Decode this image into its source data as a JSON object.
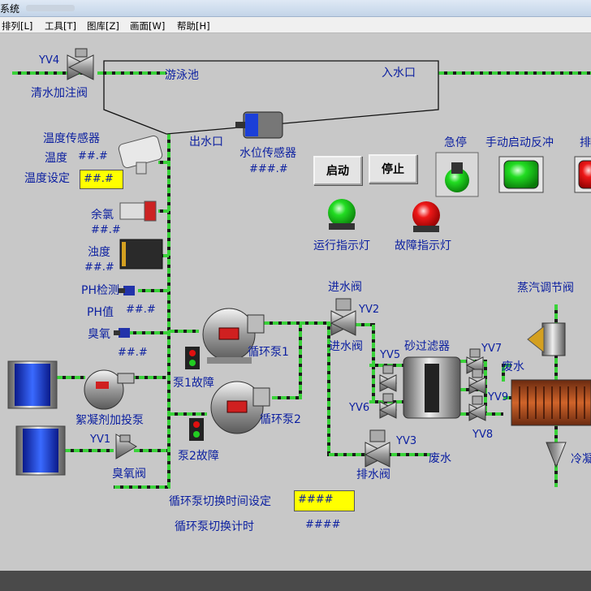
{
  "window": {
    "title": "系统"
  },
  "menu": [
    "排列[L]",
    "工具[T]",
    "图库[Z]",
    "画面[W]",
    "帮助[H]"
  ],
  "labels": {
    "yv4": "YV4",
    "clean_water_valve": "清水加注阀",
    "pool": "游泳池",
    "inlet": "入水口",
    "outlet": "出水口",
    "level_sensor": "水位传感器",
    "level_value": "###.#",
    "temp_sensor": "温度传感器",
    "temp_label": "温度",
    "temp_value": "##.#",
    "temp_setting": "温度设定",
    "temp_setting_value": "##.#",
    "chlorine": "余氯",
    "chlorine_value": "##.#",
    "turbidity": "浊度",
    "turbidity_value": "##.#",
    "ph_detect": "PH检测",
    "ph_value_label": "PH值",
    "ph_value": "##.#",
    "ozone": "臭氧",
    "ozone_value": "##.#",
    "estop": "急停",
    "manual_backwash": "手动启动反冲",
    "partial_label": "排",
    "run_indicator": "运行指示灯",
    "fault_indicator": "故障指示灯",
    "inlet_valve_top": "进水阀",
    "yv2": "YV2",
    "inlet_valve": "进水阀",
    "sand_filter": "砂过滤器",
    "yv5": "YV5",
    "yv6": "YV6",
    "yv7": "YV7",
    "yv8": "YV8",
    "yv9": "YV9",
    "waste_water_1": "废水",
    "waste_water_2": "废水",
    "steam_valve": "蒸汽调节阀",
    "cooling_partial": "冷凝",
    "pump1": "循环泵1",
    "pump1_fault": "泵1故障",
    "pump2": "循环泵2",
    "pump2_fault": "泵2故障",
    "flocculant_pump": "絮凝剂加投泵",
    "yv1": "YV1",
    "ozone_valve": "臭氧阀",
    "yv3": "YV3",
    "drain_valve": "排水阀",
    "switch_time_setting": "循环泵切换时间设定",
    "switch_time_setting_value": "####",
    "switch_timer": "循环泵切换计时",
    "switch_timer_value": "####"
  },
  "buttons": {
    "start": "启动",
    "stop": "停止"
  },
  "colors": {
    "pipe": "#39d239",
    "label": "#0b1fa0",
    "input_bg": "#ffff00",
    "run_lamp": "#1fcc1f",
    "fault_lamp": "#e01010"
  }
}
